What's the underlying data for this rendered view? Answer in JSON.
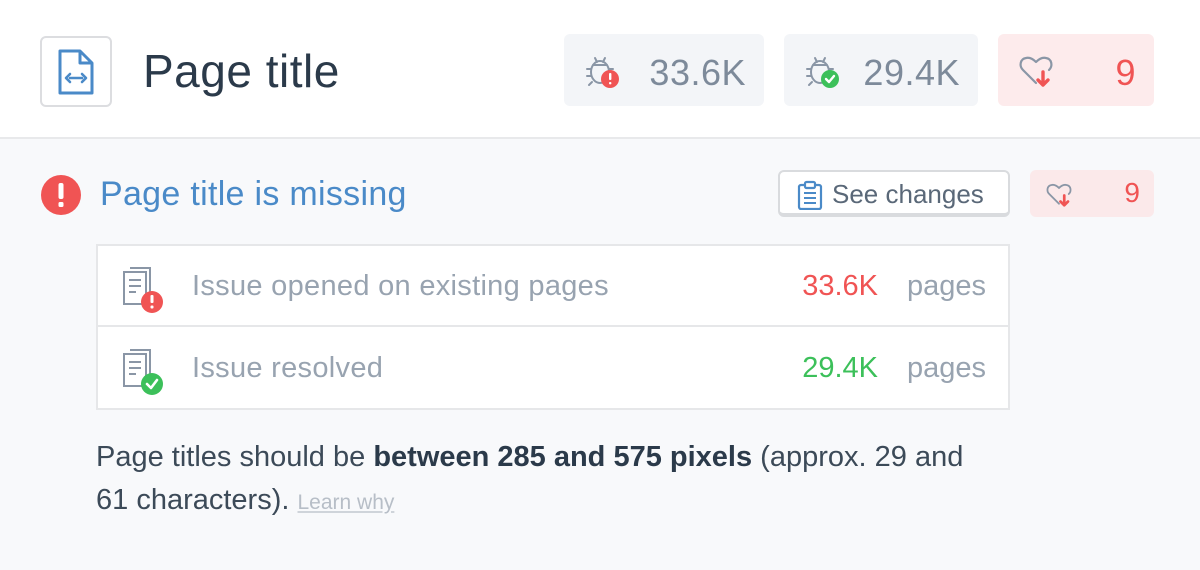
{
  "header": {
    "title": "Page title",
    "doc_icon": "file-code-icon",
    "stats": {
      "opened": {
        "icon": "bug-error-icon",
        "value": "33.6K"
      },
      "resolved": {
        "icon": "bug-check-icon",
        "value": "29.4K"
      },
      "health_drop": {
        "icon": "heart-down-icon",
        "value": "9"
      }
    }
  },
  "issue": {
    "icon": "exclamation-circle-icon",
    "title": "Page title is missing",
    "see_changes_label": "See changes",
    "see_changes_icon": "clipboard-icon",
    "health_drop": {
      "icon": "heart-down-icon",
      "value": "9"
    },
    "rows": [
      {
        "icon": "pages-error-icon",
        "label": "Issue opened on existing pages",
        "count": "33.6K",
        "unit": "pages",
        "status": "opened"
      },
      {
        "icon": "pages-check-icon",
        "label": "Issue resolved",
        "count": "29.4K",
        "unit": "pages",
        "status": "resolved"
      }
    ],
    "description": {
      "prefix": "Page titles should be ",
      "bold": "between 285 and 575 pixels",
      "suffix": " (approx. 29 and 61 characters). ",
      "link": "Learn why"
    }
  },
  "colors": {
    "accent_blue": "#4a8ac8",
    "error_red": "#f05454",
    "success_green": "#3cc05a",
    "muted_gray": "#98a3b0"
  }
}
